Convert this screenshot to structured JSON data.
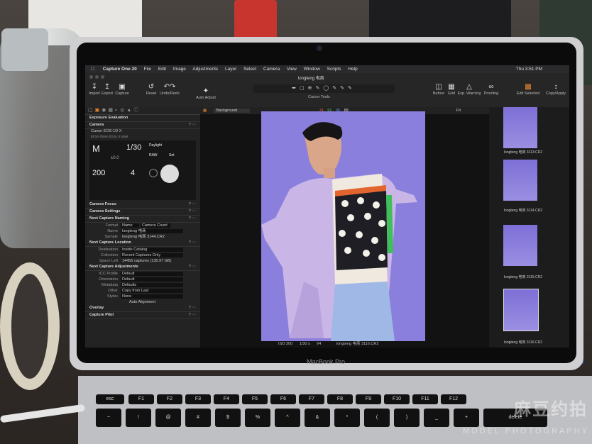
{
  "menubar": {
    "app": "Capture One 20",
    "items": [
      "File",
      "Edit",
      "Image",
      "Adjustments",
      "Layer",
      "Select",
      "Camera",
      "View",
      "Window",
      "Scripts",
      "Help"
    ],
    "clock": "Thu 3:51 PM"
  },
  "toolbar": {
    "doc_title": "longteng 电商",
    "import": "Import",
    "export": "Export",
    "capture": "Capture",
    "reset": "Reset",
    "undoredo": "Undo/Redo",
    "auto_adjust": "Auto Adjust",
    "cursor_tools": "Cursor Tools",
    "before": "Before",
    "grid": "Grid",
    "exp_warning": "Exp. Warning",
    "proofing": "Proofing",
    "edit_selected": "Edit Selected",
    "copy_apply": "Copy/Apply"
  },
  "left": {
    "exposure_evaluation": "Exposure Evaluation",
    "camera": "Camera",
    "camera_model": "Canon EOS-1D X",
    "lens": "EF24-70mm f/2.8L II USM",
    "mode": "M",
    "shutter": "1/30",
    "exposure_comp": "±0.0",
    "iso": "200",
    "aperture": "4",
    "wb": "Daylight",
    "format": "RAW",
    "set": "Set",
    "camera_focus": "Camera Focus",
    "camera_settings": "Camera Settings",
    "next_capture_naming": "Next Capture Naming",
    "format_label": "Format",
    "format_tokens": [
      "Name",
      "Camera Count"
    ],
    "name_label": "Name",
    "name_value": "longteng 电商",
    "sample_label": "Sample",
    "sample_value": "longteng 电商 3144.CR2",
    "next_capture_location": "Next Capture Location",
    "destination_label": "Destination",
    "destination_value": "Inside Catalog",
    "collection_label": "Collection",
    "collection_value": "Recent Captures Only",
    "space_left_label": "Space Left",
    "space_left_value": "14456 captures (135.97 GB)",
    "next_capture_adjustments": "Next Capture Adjustments",
    "icc_label": "ICC Profile",
    "icc_value": "Default",
    "orientation_label": "Orientation",
    "orientation_value": "Default",
    "metadata_label": "Metadata",
    "metadata_value": "Defaults",
    "other_label": "Other",
    "other_value": "Copy from Last",
    "styles_label": "Styles",
    "styles_value": "None",
    "auto_alignment": "Auto Alignment",
    "overlay": "Overlay",
    "capture_pilot": "Capture Pilot"
  },
  "viewer": {
    "collection": "Background",
    "rgb": [
      "74",
      "91",
      "96",
      "88"
    ],
    "fit": "Fit",
    "status_iso": "ISO 200",
    "status_shutter": "1/30 s",
    "status_aperture": "f/4",
    "status_filename": "longteng 电商 3116.CR2"
  },
  "filmstrip": [
    "longteng 电商 3113.CR2",
    "longteng 电商 3114.CR2",
    "longteng 电商 3115.CR2",
    "longteng 电商 3116.CR2"
  ],
  "laptop_brand": "MacBook Pro",
  "watermark": {
    "main": "麻豆约拍",
    "sub": "MODEL PHOTOGRAPHY"
  },
  "keys": [
    "esc",
    "F1",
    "F2",
    "F3",
    "F4",
    "F5",
    "F6",
    "F7",
    "F8",
    "F9",
    "F10",
    "F11",
    "F12"
  ],
  "numkeys": [
    "~",
    "!",
    "@",
    "#",
    "$",
    "%",
    "^",
    "&",
    "*",
    "(",
    ")",
    "_",
    "+",
    "delete"
  ],
  "colors": {
    "accent": "#f08a2c",
    "backdrop": "#8a7fdc"
  }
}
